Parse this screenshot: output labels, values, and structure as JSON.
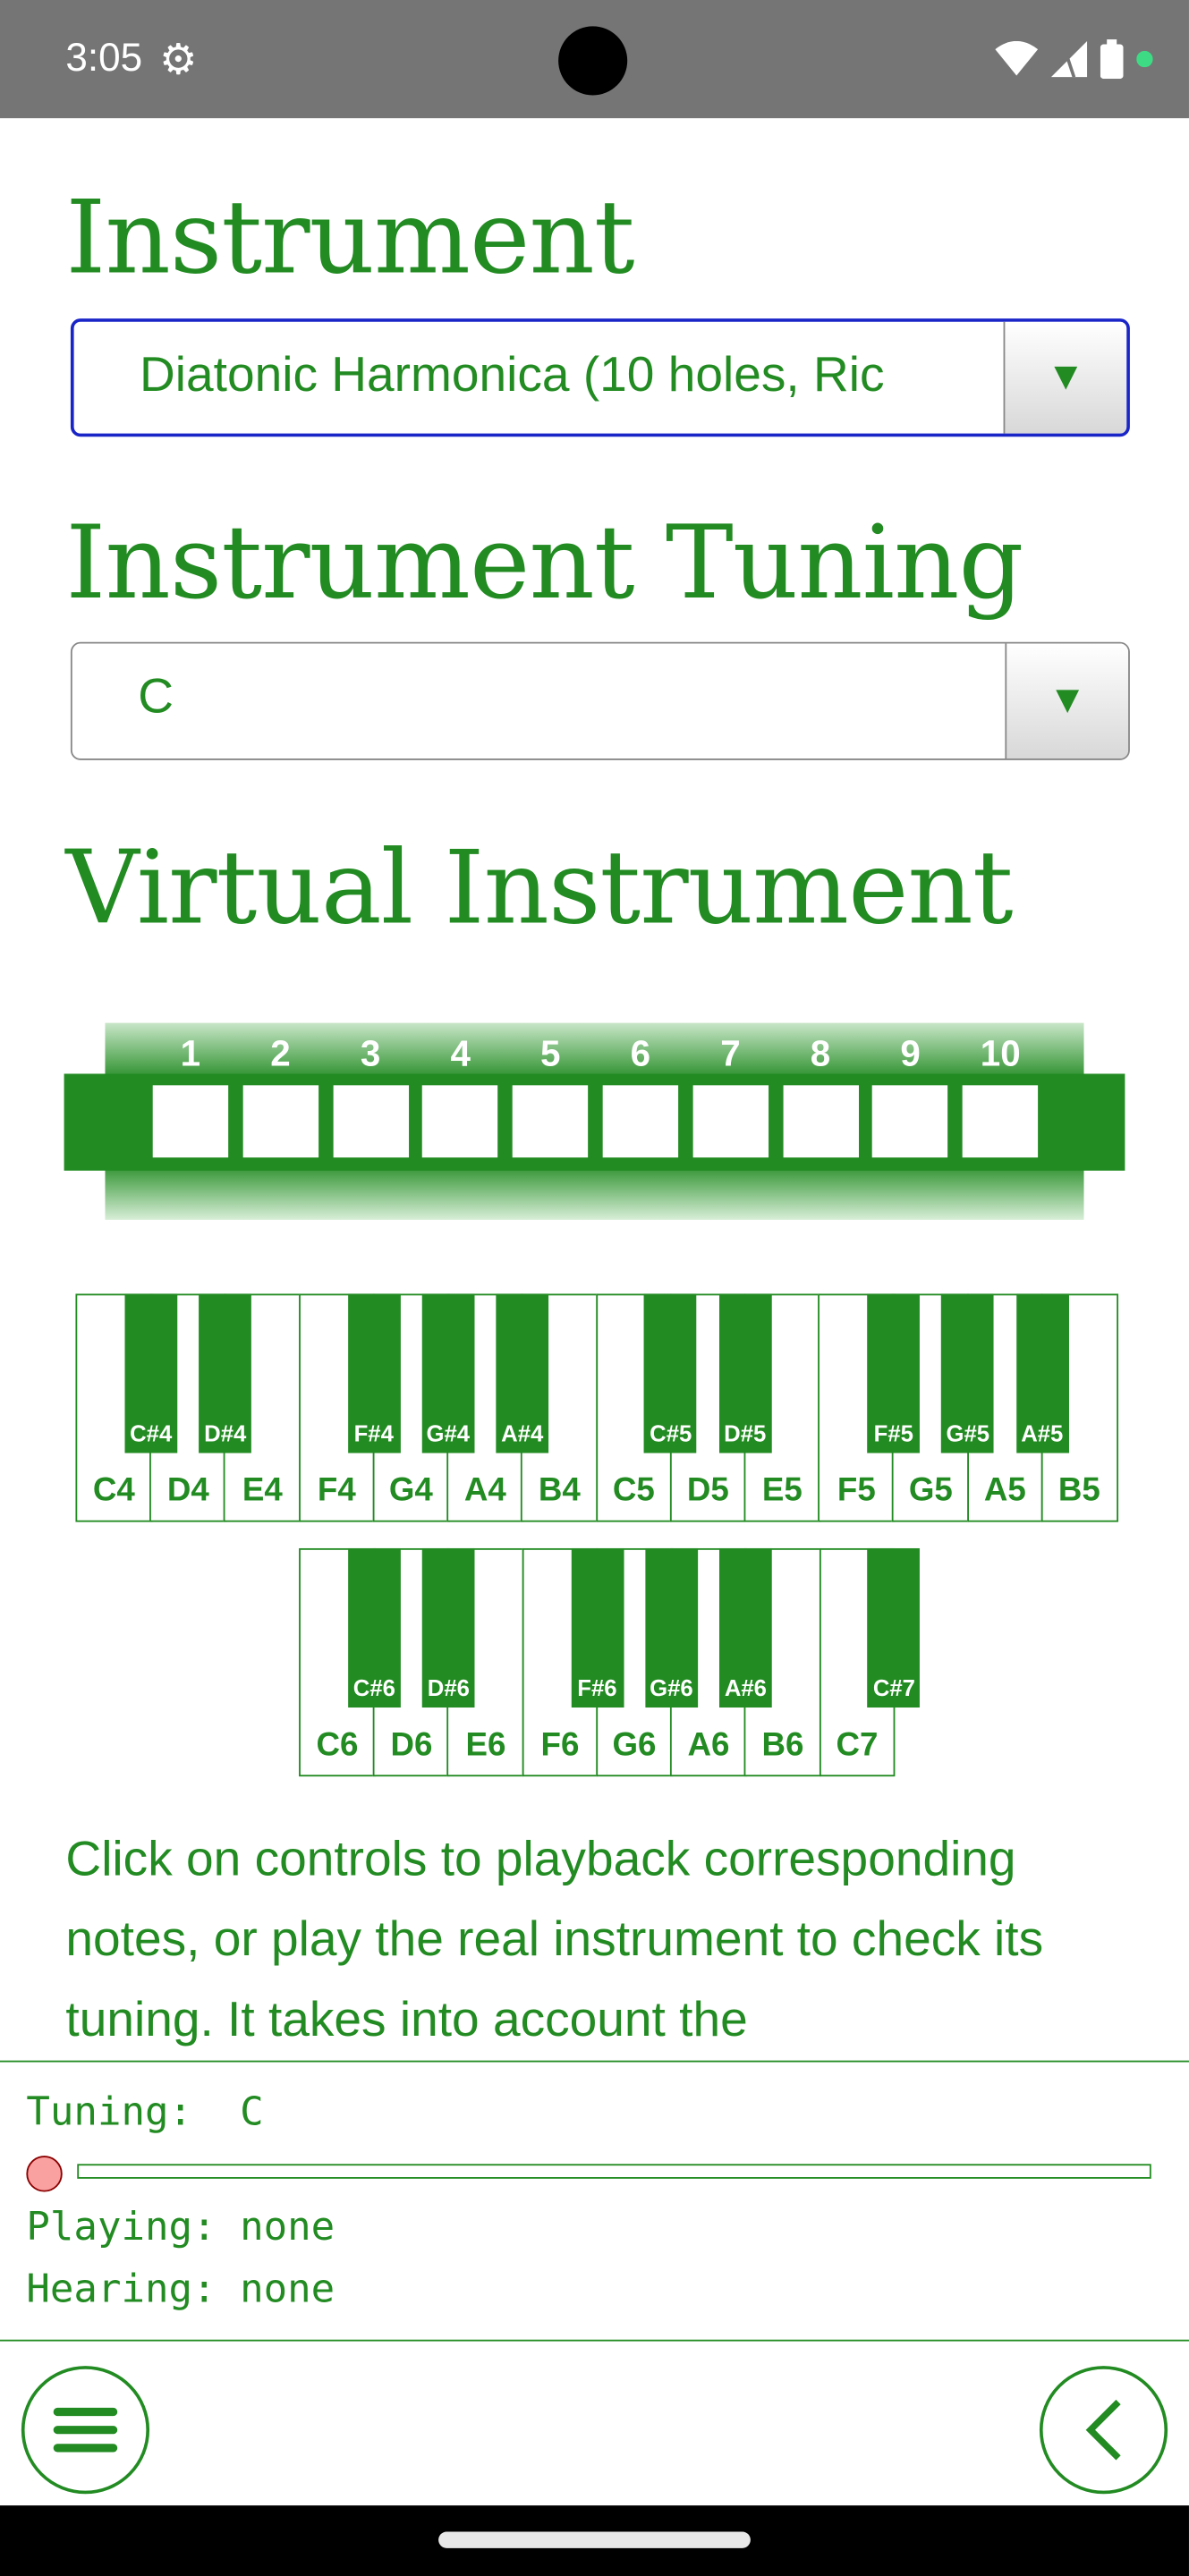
{
  "status_bar": {
    "time": "3:05",
    "icons": [
      "gear-icon",
      "camera-cutout",
      "wifi-icon",
      "signal-icon",
      "battery-icon",
      "notification-dot"
    ]
  },
  "instrument": {
    "heading": "Instrument",
    "selected": "Diatonic Harmonica (10 holes, Ric",
    "arrow": "▼"
  },
  "tuning": {
    "heading": "Instrument Tuning",
    "selected": "C",
    "arrow": "▼"
  },
  "virtual": {
    "heading": "Virtual Instrument",
    "holes": [
      "1",
      "2",
      "3",
      "4",
      "5",
      "6",
      "7",
      "8",
      "9",
      "10"
    ],
    "keyboard_row1": {
      "white": [
        "C4",
        "D4",
        "E4",
        "F4",
        "G4",
        "A4",
        "B4",
        "C5",
        "D5",
        "E5",
        "F5",
        "G5",
        "A5",
        "B5"
      ],
      "black": [
        [
          "C#4",
          0
        ],
        [
          "D#4",
          1
        ],
        [
          "F#4",
          3
        ],
        [
          "G#4",
          4
        ],
        [
          "A#4",
          5
        ],
        [
          "C#5",
          7
        ],
        [
          "D#5",
          8
        ],
        [
          "F#5",
          10
        ],
        [
          "G#5",
          11
        ],
        [
          "A#5",
          12
        ]
      ]
    },
    "keyboard_row2": {
      "white": [
        "C6",
        "D6",
        "E6",
        "F6",
        "G6",
        "A6",
        "B6",
        "C7"
      ],
      "black": [
        [
          "C#6",
          0
        ],
        [
          "D#6",
          1
        ],
        [
          "F#6",
          3
        ],
        [
          "G#6",
          4
        ],
        [
          "A#6",
          5
        ],
        [
          "C#7",
          7
        ]
      ]
    }
  },
  "description": "Click on controls to playback corresponding notes, or play the real instrument to check its tuning. It takes into account the",
  "panel": {
    "tuning": "Tuning:  C",
    "level": 0,
    "playing": "Playing: none",
    "hearing": "Hearing: none",
    "accent": "#228B22",
    "indicator": "#f9a0a0"
  },
  "bottom": {
    "menu_icon": "hamburger-menu-icon",
    "back_icon": "chevron-left-icon"
  }
}
